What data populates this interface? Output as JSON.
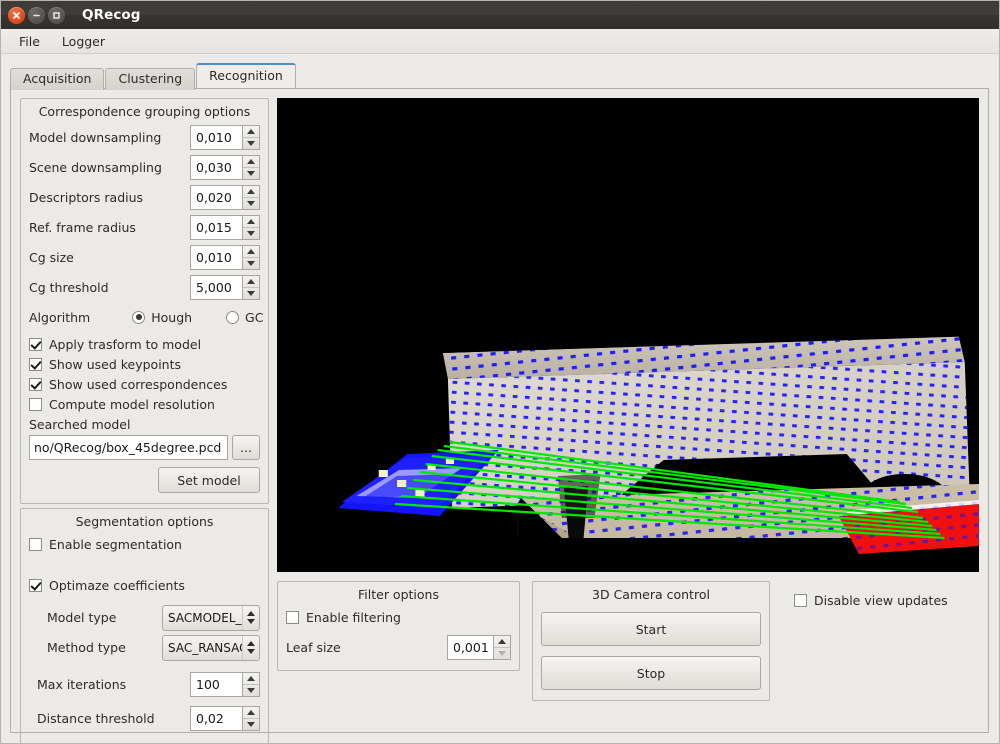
{
  "window": {
    "title": "QRecog",
    "controls": [
      {
        "name": "close-button",
        "icon": "close-icon"
      },
      {
        "name": "minimize-button",
        "icon": "minimize-icon"
      },
      {
        "name": "maximize-button",
        "icon": "maximize-icon"
      }
    ]
  },
  "menubar": {
    "items": [
      {
        "label": "File"
      },
      {
        "label": "Logger"
      }
    ]
  },
  "tabs": [
    {
      "label": "Acquisition",
      "active": false
    },
    {
      "label": "Clustering",
      "active": false
    },
    {
      "label": "Recognition",
      "active": true
    }
  ],
  "correspondence_group": {
    "title": "Correspondence grouping options",
    "fields": [
      {
        "label": "Model downsampling",
        "value": "0,010"
      },
      {
        "label": "Scene downsampling",
        "value": "0,030"
      },
      {
        "label": "Descriptors radius",
        "value": "0,020"
      },
      {
        "label": "Ref. frame radius",
        "value": "0,015"
      },
      {
        "label": "Cg size",
        "value": "0,010"
      },
      {
        "label": "Cg threshold",
        "value": "5,000"
      }
    ],
    "algorithm": {
      "label": "Algorithm",
      "options": [
        {
          "label": "Hough",
          "selected": true
        },
        {
          "label": "GC",
          "selected": false
        }
      ]
    },
    "checkboxes": [
      {
        "label": "Apply trasform to model",
        "checked": true
      },
      {
        "label": "Show used keypoints",
        "checked": true
      },
      {
        "label": "Show used correspondences",
        "checked": true
      },
      {
        "label": "Compute model resolution",
        "checked": false
      }
    ],
    "searched_model": {
      "label": "Searched model",
      "value": "no/QRecog/box_45degree.pcd",
      "placeholder": "",
      "browse_label": "...",
      "set_model_label": "Set model"
    }
  },
  "segmentation_group": {
    "title": "Segmentation options",
    "enable": {
      "label": "Enable segmentation",
      "checked": false
    },
    "optimize": {
      "label": "Optimaze coefficients",
      "checked": true
    },
    "model_type": {
      "label": "Model type",
      "value": "SACMODEL_"
    },
    "method_type": {
      "label": "Method type",
      "value": "SAC_RANSAC"
    },
    "max_iterations": {
      "label": "Max iterations",
      "value": "100"
    },
    "distance_threshold": {
      "label": "Distance threshold",
      "value": "0,02"
    }
  },
  "filter_group": {
    "title": "Filter options",
    "enable": {
      "label": "Enable filtering",
      "checked": false
    },
    "leaf_size": {
      "label": "Leaf size",
      "value": "0,001"
    }
  },
  "camera_group": {
    "title": "3D Camera control",
    "start_label": "Start",
    "stop_label": "Stop"
  },
  "view_options": {
    "disable_view_updates": {
      "label": "Disable view updates",
      "checked": false
    }
  },
  "viewport": {
    "name": "point-cloud-viewport",
    "background": "#000000",
    "scene_colors": {
      "keypoints": "#0000ff",
      "correspondence_lines": "#00ff00",
      "model_match": "#ff0000",
      "surface": "#c9bfae"
    }
  }
}
